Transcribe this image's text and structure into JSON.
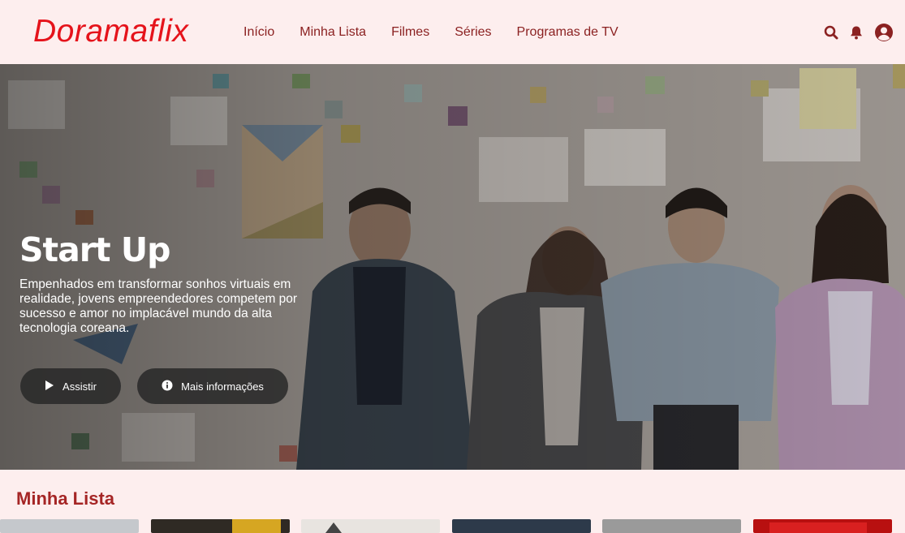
{
  "header": {
    "logo": "Doramaflix",
    "nav": [
      "Início",
      "Minha Lista",
      "Filmes",
      "Séries",
      "Programas de TV"
    ],
    "icons": [
      "search-icon",
      "bell-icon",
      "user-icon"
    ]
  },
  "hero": {
    "title": "Start Up",
    "description": "Empenhados em transformar sonhos virtuais em realidade, jovens empreendedores competem por sucesso e amor no implacável mundo da alta tecnologia coreana.",
    "play_label": "Assistir",
    "info_label": "Mais informações"
  },
  "section": {
    "title": "Minha Lista",
    "cards": 6
  },
  "colors": {
    "brand": "#e5131b",
    "nav_text": "#8b2121",
    "background": "#fdeeee",
    "section_title": "#a52525"
  }
}
